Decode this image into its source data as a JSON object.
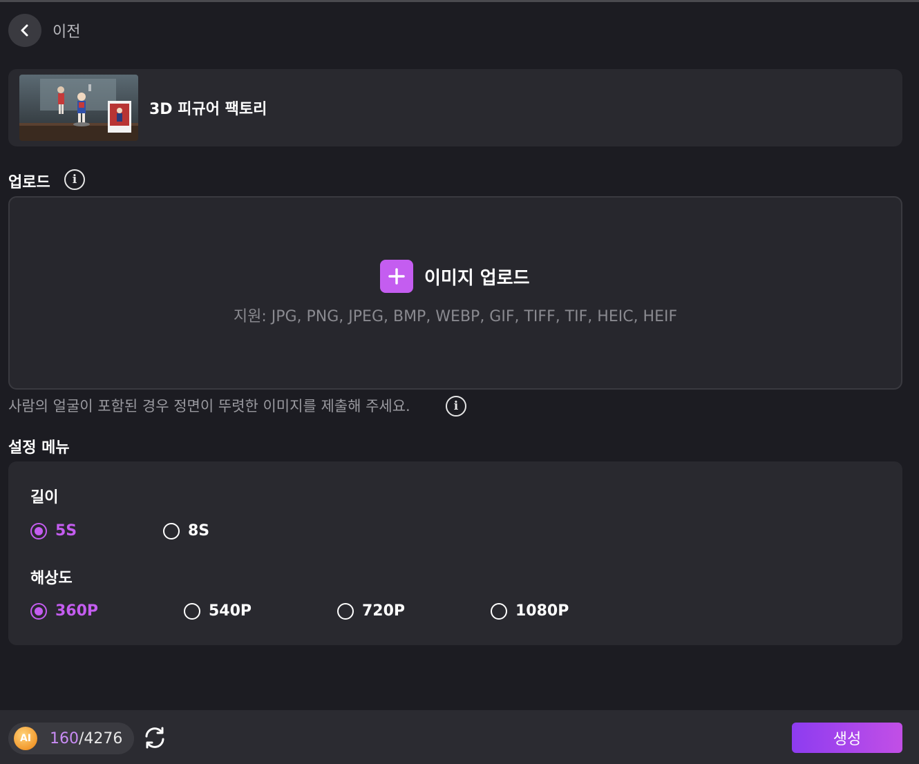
{
  "nav": {
    "back_label": "이전"
  },
  "template": {
    "title": "3D 피규어 팩토리",
    "thumbnail_icon": "figure-thumbnail"
  },
  "upload": {
    "section_label": "업로드",
    "title": "이미지 업로드",
    "supported_formats": "지원: JPG, PNG, JPEG, BMP, WEBP, GIF, TIFF, TIF, HEIC, HEIF",
    "hint": "사람의 얼굴이 포함된 경우 정면이 뚜렷한 이미지를 제출해 주세요."
  },
  "settings": {
    "section_label": "설정 메뉴",
    "duration": {
      "label": "길이",
      "options": [
        {
          "label": "5S",
          "selected": true
        },
        {
          "label": "8S",
          "selected": false
        }
      ]
    },
    "resolution": {
      "label": "해상도",
      "options": [
        {
          "label": "360P",
          "selected": true
        },
        {
          "label": "540P",
          "selected": false
        },
        {
          "label": "720P",
          "selected": false
        },
        {
          "label": "1080P",
          "selected": false
        }
      ]
    }
  },
  "footer": {
    "ai_badge": "AI",
    "credits_used": "160",
    "credits_separator": "/",
    "credits_total": "4276",
    "generate_label": "생성"
  },
  "colors": {
    "accent": "#c45df0",
    "background": "#1c1c22",
    "card": "#29292f",
    "button_gradient": [
      "#8d3cf0",
      "#c24fe6"
    ]
  }
}
